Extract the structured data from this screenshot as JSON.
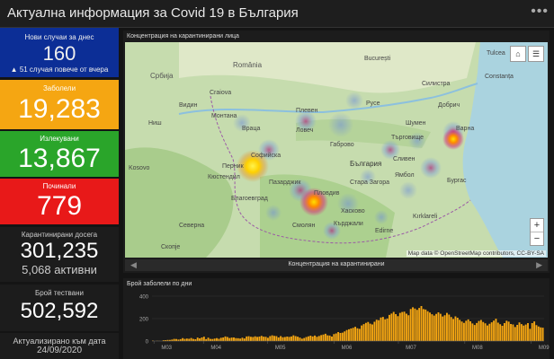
{
  "header": {
    "title": "Актуална информация за Covid 19 в България",
    "menu_icon": "more-dots-icon"
  },
  "cards": {
    "new_cases": {
      "label": "Нови случаи за днес",
      "value": "160",
      "sub": "▲ 51 случая повече от вчера",
      "color": "#0c2e96"
    },
    "infected": {
      "label": "Заболели",
      "value": "19,283",
      "color": "#f5a612"
    },
    "recovered": {
      "label": "Излекувани",
      "value": "13,867",
      "color": "#2aa52a"
    },
    "deceased": {
      "label": "Починали",
      "value": "779",
      "color": "#e81919"
    },
    "quarantined": {
      "label": "Карантинирани досега",
      "value": "301,235",
      "sub": "5,068 активни"
    },
    "tested": {
      "label": "Брой тествани",
      "value": "502,592"
    },
    "updated": {
      "label": "Актуализирано към дата",
      "date": "24/09/2020"
    }
  },
  "map": {
    "title": "Концентрация на карантинирани лица",
    "footer_title": "Концентрация на карантинирани",
    "attribution": "Map data © OpenStreetMap contributors, CC-BY-SA",
    "zoom_in": "+",
    "zoom_out": "−",
    "home_icon": "home-icon",
    "legend_icon": "list-icon",
    "labels": {
      "bucharest": "București",
      "romania": "România",
      "craiova": "Craiova",
      "serbia": "Србија",
      "kosovo": "Kosovo",
      "bulgaria": "България",
      "sofia": "Софийска",
      "varna": "Варна",
      "burgas": "Бургас",
      "severna": "Северна",
      "kirklareli": "Kırklareli",
      "edirne": "Edirne",
      "plovdiv": "Пловдив",
      "ruse": "Русе",
      "pleven": "Плевен",
      "silistra": "Силистра",
      "dobrich": "Добрич",
      "shumen": "Шумен",
      "gabrovo": "Габрово",
      "haskovo": "Хасково",
      "kardzhali": "Кърджали",
      "smolyan": "Смолян",
      "blagoevgrad": "Благоевград",
      "kyustendil": "Кюстендил",
      "vidin": "Видин",
      "montana": "Монтана",
      "vratsa": "Враца",
      "lovech": "Ловеч",
      "turgovishte": "Търговище",
      "yambol": "Ямбол",
      "sliven": "Сливен",
      "pernik": "Перник",
      "pazardzhik": "Пазарджик",
      "stara_zagora": "Стара Загора",
      "constanta": "Constanța",
      "tulcea": "Tulcea",
      "nis": "Ниш",
      "skopje": "Скопје"
    }
  },
  "chart_data": {
    "type": "bar",
    "title": "Брой заболели по дни",
    "xlabel": "",
    "ylabel": "",
    "ylim": [
      0,
      400
    ],
    "y_ticks": [
      0,
      200,
      400
    ],
    "x_ticks": [
      "M03",
      "M04",
      "M05",
      "M06",
      "M07",
      "M08",
      "M09"
    ],
    "bar_color": "#f5a612",
    "start": "2020-03-08",
    "values": [
      4,
      0,
      2,
      1,
      0,
      7,
      8,
      10,
      10,
      13,
      19,
      18,
      13,
      17,
      26,
      19,
      22,
      20,
      27,
      19,
      16,
      31,
      24,
      32,
      39,
      17,
      30,
      19,
      18,
      22,
      26,
      20,
      29,
      32,
      41,
      36,
      27,
      31,
      32,
      26,
      25,
      22,
      30,
      23,
      41,
      43,
      38,
      36,
      42,
      37,
      40,
      46,
      39,
      38,
      29,
      44,
      51,
      46,
      44,
      32,
      44,
      34,
      36,
      40,
      37,
      41,
      51,
      44,
      39,
      31,
      21,
      27,
      36,
      42,
      48,
      41,
      49,
      38,
      45,
      53,
      58,
      65,
      51,
      49,
      40,
      62,
      68,
      80,
      72,
      75,
      86,
      98,
      105,
      112,
      118,
      127,
      114,
      109,
      139,
      151,
      162,
      170,
      155,
      148,
      172,
      190,
      186,
      210,
      215,
      194,
      201,
      233,
      245,
      260,
      240,
      222,
      251,
      259,
      262,
      244,
      230,
      286,
      301,
      290,
      278,
      295,
      312,
      285,
      281,
      266,
      254,
      239,
      227,
      242,
      256,
      243,
      219,
      230,
      251,
      236,
      214,
      197,
      220,
      208,
      189,
      174,
      162,
      181,
      193,
      176,
      157,
      143,
      161,
      179,
      188,
      170,
      158,
      139,
      154,
      167,
      182,
      199,
      164,
      150,
      136,
      160,
      181,
      173,
      152,
      148,
      125,
      144,
      166,
      151,
      138,
      147,
      160,
      109,
      160,
      175,
      142,
      130,
      122,
      119
    ]
  }
}
